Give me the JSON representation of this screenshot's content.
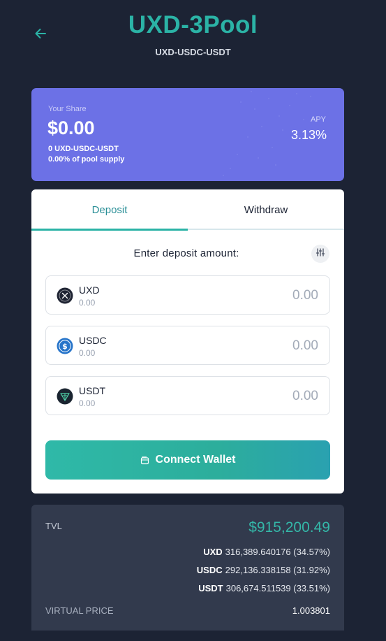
{
  "header": {
    "title": "UXD-3Pool",
    "subtitle": "UXD-USDC-USDT",
    "back_icon": "arrow-left-icon"
  },
  "share": {
    "label": "Your Share",
    "value": "$0.00",
    "lp_amount": "0 UXD-USDC-USDT",
    "pool_pct": "0.00% of pool supply",
    "apy_label": "APY",
    "apy_value": "3.13%"
  },
  "tabs": [
    {
      "label": "Deposit",
      "active": true
    },
    {
      "label": "Withdraw",
      "active": false
    }
  ],
  "deposit": {
    "prompt": "Enter deposit amount:",
    "settings_icon": "sliders-icon",
    "tokens": [
      {
        "symbol": "UXD",
        "balance": "0.00",
        "amount_placeholder": "0.00",
        "icon": "uxd-token-icon"
      },
      {
        "symbol": "USDC",
        "balance": "0.00",
        "amount_placeholder": "0.00",
        "icon": "usdc-token-icon"
      },
      {
        "symbol": "USDT",
        "balance": "0.00",
        "amount_placeholder": "0.00",
        "icon": "usdt-token-icon"
      }
    ],
    "connect_label": "Connect Wallet",
    "connect_icon": "wallet-icon"
  },
  "stats": {
    "tvl_label": "TVL",
    "tvl_value": "$915,200.49",
    "reserves": [
      {
        "symbol": "UXD",
        "amount": "316,389.640176 (34.57%)"
      },
      {
        "symbol": "USDC",
        "amount": "292,136.338158 (31.92%)"
      },
      {
        "symbol": "USDT",
        "amount": "306,674.511539 (33.51%)"
      }
    ],
    "virtual_price_label": "VIRTUAL PRICE",
    "virtual_price_value": "1.003801"
  },
  "colors": {
    "background": "#1c2334",
    "accent": "#2bb3a6",
    "share_card": "#6c71e6",
    "stats_card": "#323a4d"
  }
}
